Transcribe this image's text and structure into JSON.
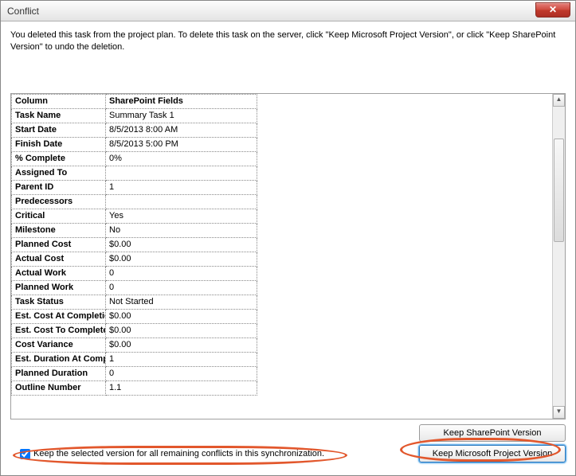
{
  "titlebar": {
    "title": "Conflict"
  },
  "message": "You deleted this task from the project plan. To delete this task on the server, click \"Keep Microsoft Project Version\", or click \"Keep SharePoint Version\" to undo the deletion.",
  "grid": {
    "header_col": "Column",
    "header_val": "SharePoint Fields",
    "rows": [
      {
        "label": "Task Name",
        "value": "Summary Task 1"
      },
      {
        "label": "Start Date",
        "value": "8/5/2013 8:00 AM"
      },
      {
        "label": "Finish Date",
        "value": "8/5/2013 5:00 PM"
      },
      {
        "label": "% Complete",
        "value": "0%"
      },
      {
        "label": "Assigned To",
        "value": ""
      },
      {
        "label": "Parent ID",
        "value": "1"
      },
      {
        "label": "Predecessors",
        "value": ""
      },
      {
        "label": "Critical",
        "value": "Yes"
      },
      {
        "label": "Milestone",
        "value": "No"
      },
      {
        "label": "Planned Cost",
        "value": "$0.00"
      },
      {
        "label": "Actual Cost",
        "value": "$0.00"
      },
      {
        "label": "Actual Work",
        "value": "0"
      },
      {
        "label": "Planned Work",
        "value": "0"
      },
      {
        "label": "Task Status",
        "value": "Not Started"
      },
      {
        "label": "Est. Cost At Completio",
        "value": "$0.00"
      },
      {
        "label": "Est. Cost To Complete",
        "value": "$0.00"
      },
      {
        "label": "Cost Variance",
        "value": "$0.00"
      },
      {
        "label": "Est. Duration At Comp",
        "value": "1"
      },
      {
        "label": "Planned Duration",
        "value": "0"
      },
      {
        "label": "Outline Number",
        "value": "1.1"
      }
    ]
  },
  "buttons": {
    "keep_sp": "Keep SharePoint Version",
    "keep_msp": "Keep Microsoft Project Version"
  },
  "checkbox": {
    "checked": true,
    "label": "Keep the selected version for all remaining conflicts in this synchronization."
  }
}
